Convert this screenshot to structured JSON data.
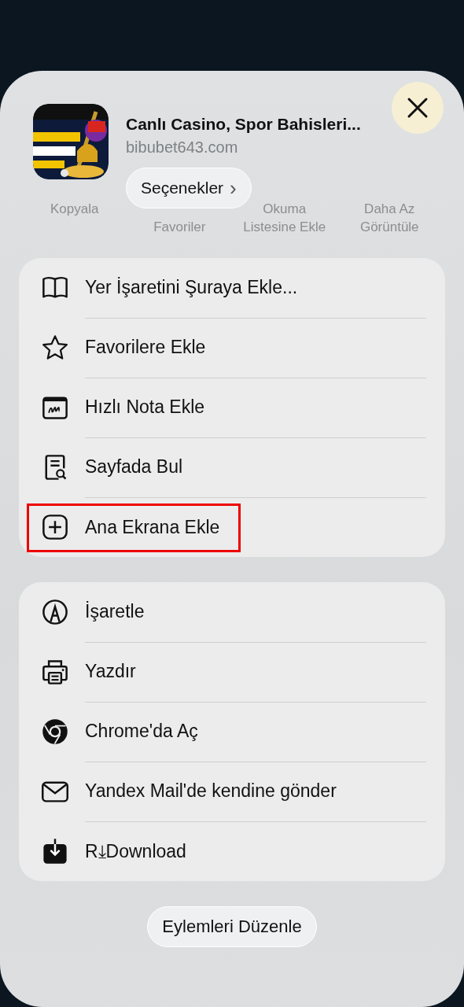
{
  "header": {
    "title": "Canlı Casino, Spor Bahisleri...",
    "domain": "bibubet643.com",
    "options_button": "Seçenekler",
    "chevron": "›"
  },
  "background_actions": [
    {
      "lines": [
        "Kopyala"
      ]
    },
    {
      "lines": [
        "Favoriler"
      ]
    },
    {
      "lines": [
        "Okuma",
        "Listesine Ekle"
      ]
    },
    {
      "lines": [
        "Daha Az",
        "Görüntüle"
      ]
    }
  ],
  "groups": [
    {
      "items": [
        {
          "label": "Yer İşaretini Şuraya Ekle...",
          "highlighted": false
        },
        {
          "label": "Favorilere Ekle",
          "highlighted": false
        },
        {
          "label": "Hızlı Nota Ekle",
          "highlighted": false
        },
        {
          "label": "Sayfada Bul",
          "highlighted": false
        },
        {
          "label": "Ana Ekrana Ekle",
          "highlighted": true
        }
      ]
    },
    {
      "items": [
        {
          "label": "İşaretle",
          "highlighted": false
        },
        {
          "label": "Yazdır",
          "highlighted": false
        },
        {
          "label": "Chrome'da Aç",
          "highlighted": false
        },
        {
          "label": "Yandex Mail'de kendine gönder",
          "highlighted": false
        },
        {
          "label": "R⤓Download",
          "highlighted": false
        }
      ]
    }
  ],
  "edit_button": "Eylemleri Düzenle"
}
